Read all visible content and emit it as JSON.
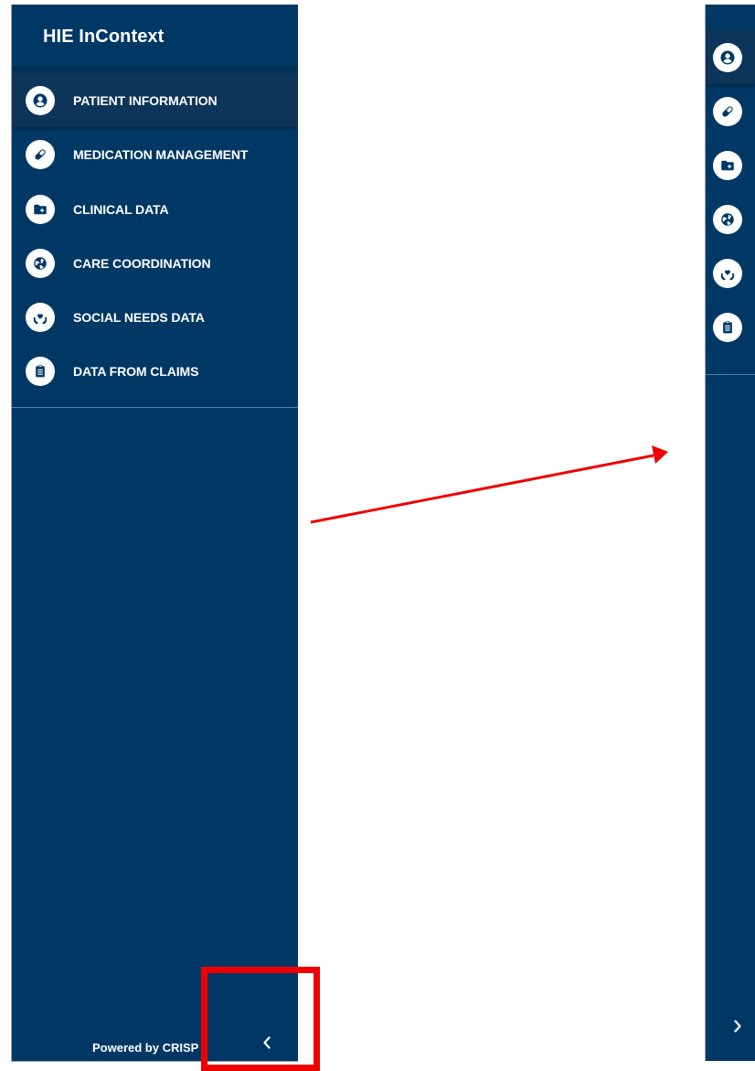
{
  "app": {
    "title": "HIE InContext"
  },
  "nav": {
    "items": [
      {
        "label": "PATIENT INFORMATION",
        "icon": "user-circle-icon"
      },
      {
        "label": "MEDICATION MANAGEMENT",
        "icon": "pill-icon"
      },
      {
        "label": "CLINICAL DATA",
        "icon": "folder-plus-icon"
      },
      {
        "label": "CARE COORDINATION",
        "icon": "globe-icon"
      },
      {
        "label": "SOCIAL NEEDS DATA",
        "icon": "hands-heart-icon"
      },
      {
        "label": "DATA FROM CLAIMS",
        "icon": "clipboard-icon"
      }
    ]
  },
  "footer": {
    "powered_by": "Powered by CRISP",
    "collapse_icon": "chevron-left-icon",
    "expand_icon": "chevron-right-icon"
  },
  "annotation": {
    "highlight_color": "#ee0000",
    "arrow_color": "#ee0000"
  },
  "colors": {
    "sidebar_bg": "#003865",
    "active_item_bg": "#0d3459",
    "icon_bg": "#ffffff",
    "text": "#ffffff"
  }
}
